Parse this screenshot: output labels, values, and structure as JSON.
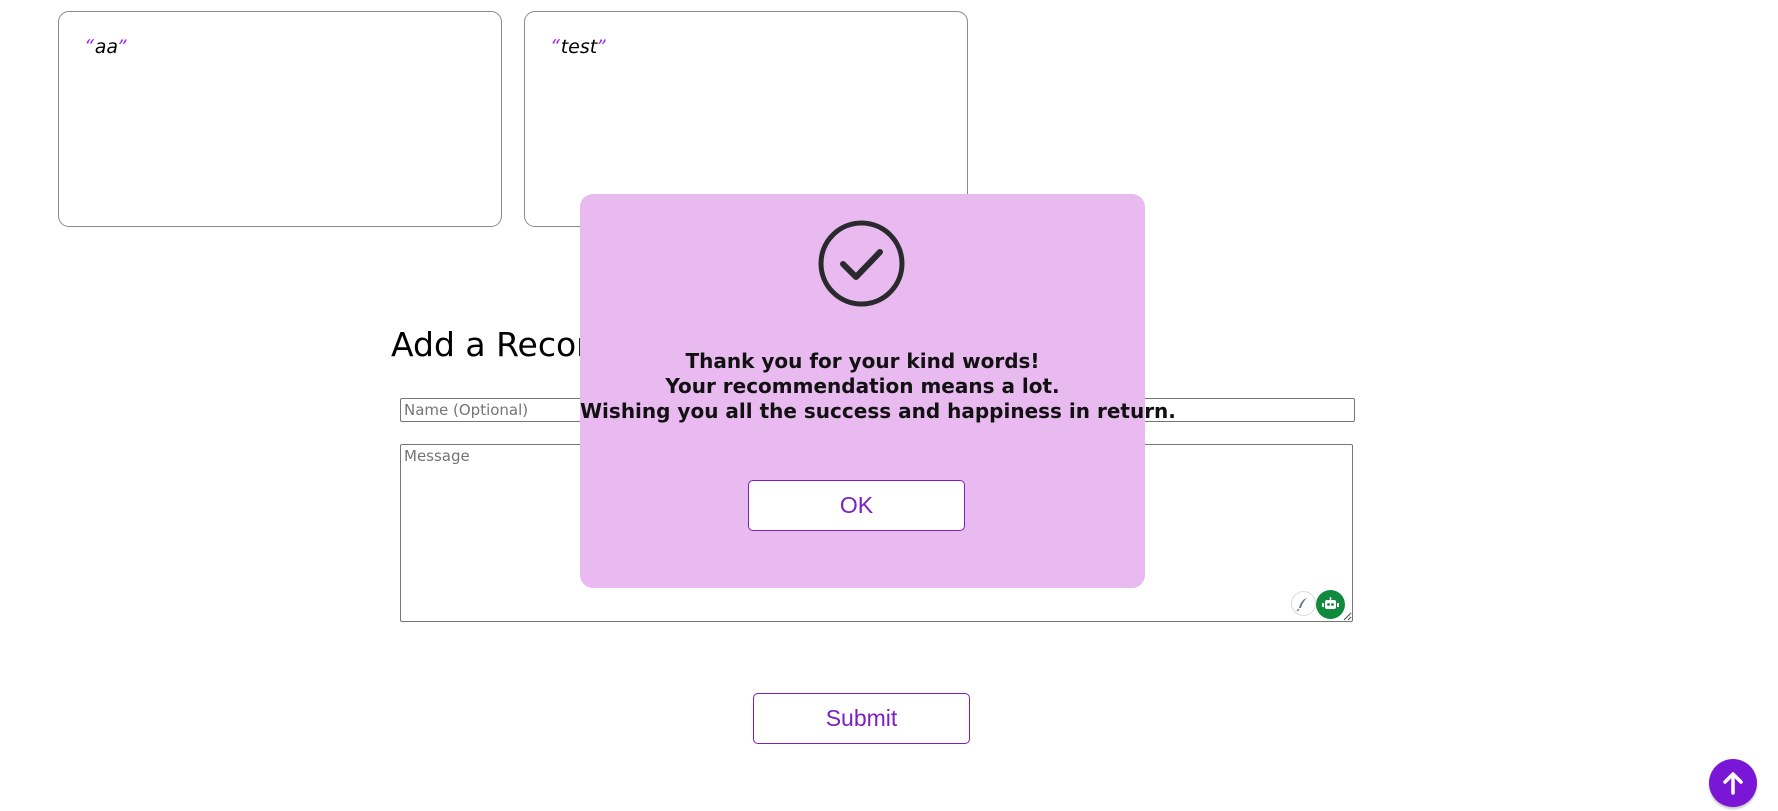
{
  "recommendations": [
    {
      "text": "aa",
      "open_quote": "“",
      "close_quote": "”"
    },
    {
      "text": "test",
      "open_quote": "“",
      "close_quote": "”"
    }
  ],
  "form": {
    "title": "Add a Recommendation",
    "name_placeholder": "Name (Optional)",
    "message_placeholder": "Message",
    "submit_label": "Submit"
  },
  "modal": {
    "icon": "check-circle-icon",
    "line1": "Thank you for your kind words!",
    "line2": "Your recommendation means a lot.",
    "line3": "Wishing you all the success and happiness in return.",
    "ok_label": "OK"
  },
  "colors": {
    "accent": "#7b1fc2",
    "modal_bg": "#e8baf0",
    "scroll_top_bg": "#7a16d6",
    "ext_bot_bg": "#118a3e"
  },
  "icons": {
    "scroll_top": "arrow-up-icon",
    "ext1": "feather-icon",
    "ext2": "bot-icon"
  }
}
